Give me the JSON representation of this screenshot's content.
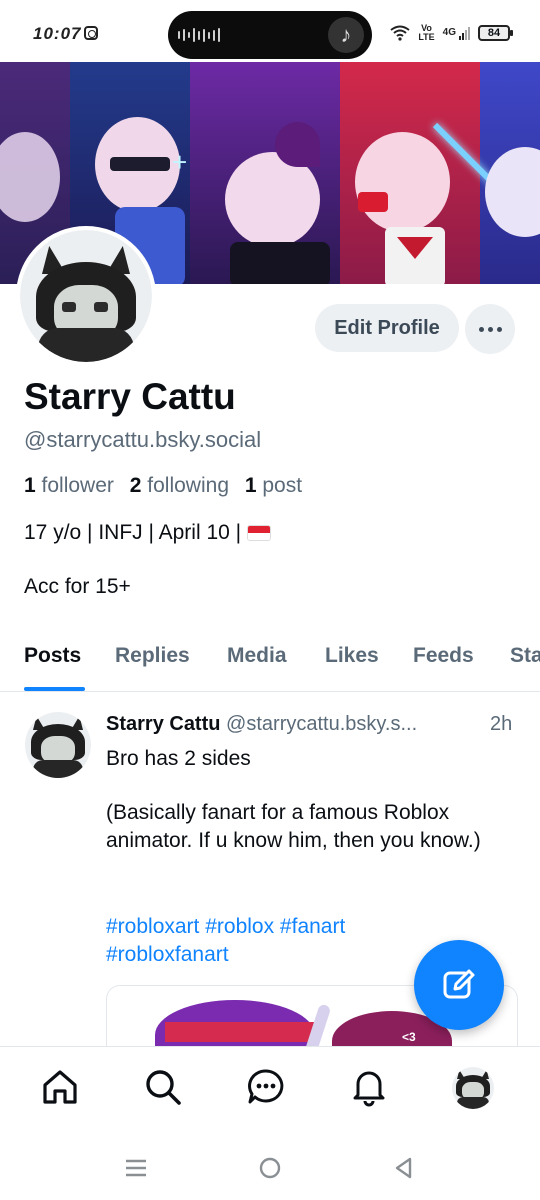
{
  "status_bar": {
    "time": "10:07",
    "network_volte_top": "Vo",
    "network_volte_bottom": "LTE",
    "network_type": "4G",
    "battery": "84"
  },
  "profile": {
    "display_name": "Starry Cattu",
    "handle": "@starrycattu.bsky.social",
    "followers_count": "1",
    "followers_label": "follower",
    "following_count": "2",
    "following_label": "following",
    "posts_count": "1",
    "posts_label": "post",
    "bio_line1": "17 y/o | INFJ | April 10 |",
    "bio_flag_icon": "indonesia-flag-icon",
    "bio_line2": "Acc for 15+",
    "edit_button_label": "Edit Profile",
    "more_button_icon": "more-icon"
  },
  "tabs": [
    {
      "label": "Posts",
      "active": true
    },
    {
      "label": "Replies",
      "active": false
    },
    {
      "label": "Media",
      "active": false
    },
    {
      "label": "Likes",
      "active": false
    },
    {
      "label": "Feeds",
      "active": false
    },
    {
      "label": "Sta",
      "active": false
    }
  ],
  "post": {
    "author": "Starry Cattu",
    "handle": "@starrycattu.bsky.s...",
    "time": "2h",
    "line1": "Bro has 2 sides",
    "paragraph": "(Basically fanart for a famous Roblox animator. If u know him, then you know.)",
    "tags": "#robloxart #roblox #fanart #robloxfanart"
  },
  "fab": {
    "icon": "compose-icon"
  },
  "bottom_nav": [
    {
      "icon": "home-icon"
    },
    {
      "icon": "search-icon"
    },
    {
      "icon": "chat-icon"
    },
    {
      "icon": "bell-icon"
    },
    {
      "icon": "profile-avatar-icon"
    }
  ],
  "colors": {
    "accent": "#1083fe",
    "muted_text": "#5b6a78",
    "button_bg": "#edf0f3"
  }
}
